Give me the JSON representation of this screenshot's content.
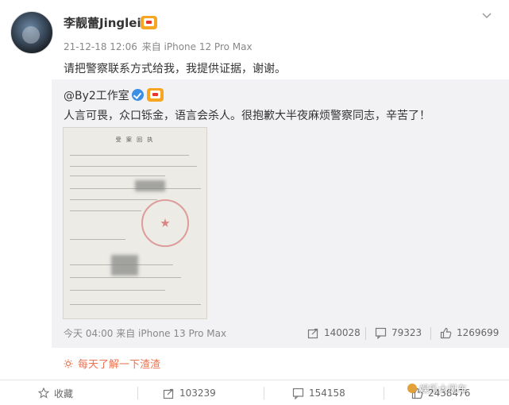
{
  "post": {
    "username": "李靓蕾Jinglei",
    "time": "21-12-18 12:06",
    "source": "来自 iPhone 12 Pro Max",
    "text": "请把警察联系方式给我，我提供证据，谢谢。"
  },
  "repost": {
    "author": "@By2工作室",
    "text": "人言可畏，众口铄金，语言会杀人。很抱歉大半夜麻烦警察同志，辛苦了！",
    "time": "今天 04:00",
    "source": "来自 iPhone 13 Pro Max",
    "reposts": "140028",
    "comments": "79323",
    "likes": "1269699",
    "document": {
      "title": "受 案 回 执"
    }
  },
  "promo": {
    "text": "每天了解一下渣渣"
  },
  "actions": {
    "favorite": "收藏",
    "repost": "103239",
    "comment": "154158",
    "like": "2438476"
  },
  "watermark": {
    "text": "娱乐大风车"
  },
  "colors": {
    "promo": "#eb7350",
    "verified": "#3a8ee6",
    "badge": "#f6a623"
  }
}
